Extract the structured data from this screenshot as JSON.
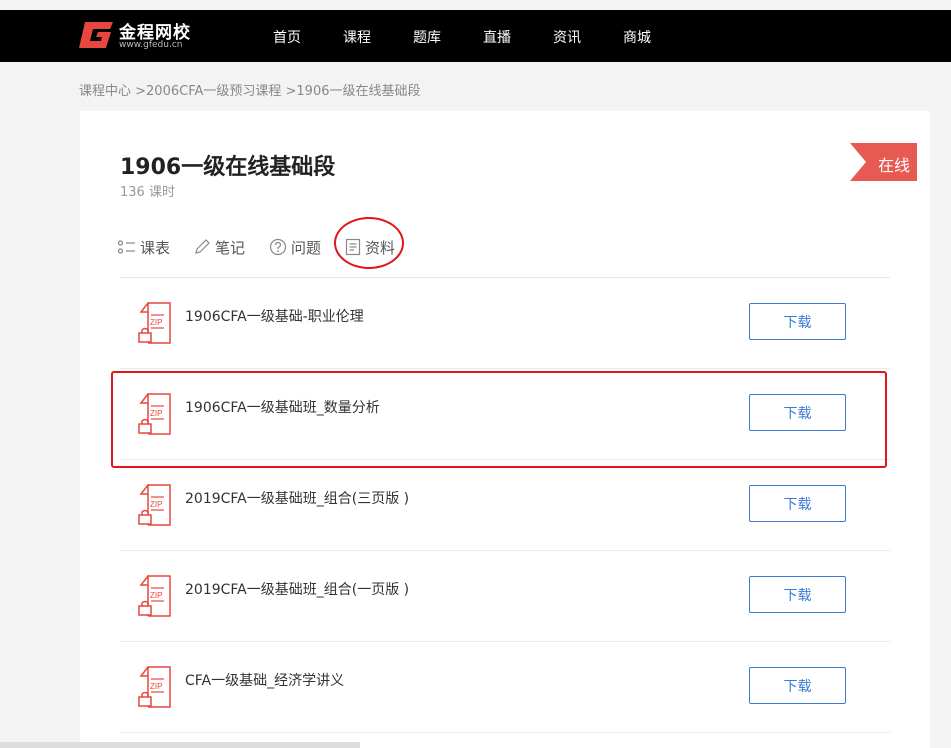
{
  "header": {
    "logo_name": "金程网校",
    "logo_url": "www.gfedu.cn",
    "nav": [
      "首页",
      "课程",
      "题库",
      "直播",
      "资讯",
      "商城"
    ]
  },
  "breadcrumb": [
    "课程中心 >",
    "2006CFA一级预习课程 >",
    "1906一级在线基础段"
  ],
  "course": {
    "title": "1906一级在线基础段",
    "hours": "136 课时",
    "badge": "在线"
  },
  "tabs": [
    {
      "label": "课表",
      "icon": "list-icon"
    },
    {
      "label": "笔记",
      "icon": "pencil-icon"
    },
    {
      "label": "问题",
      "icon": "question-icon"
    },
    {
      "label": "资料",
      "icon": "document-icon"
    }
  ],
  "files": [
    {
      "name": "1906CFA一级基础-职业伦理",
      "icon": "zip-file-icon",
      "action": "下载"
    },
    {
      "name": "1906CFA一级基础班_数量分析",
      "icon": "zip-file-icon",
      "action": "下载"
    },
    {
      "name": "2019CFA一级基础班_组合(三页版 )",
      "icon": "zip-file-icon",
      "action": "下载"
    },
    {
      "name": "2019CFA一级基础班_组合(一页版 )",
      "icon": "zip-file-icon",
      "action": "下载"
    },
    {
      "name": "CFA一级基础_经济学讲义",
      "icon": "zip-file-icon",
      "action": "下载"
    }
  ],
  "colors": {
    "nav_bg": "#000000",
    "accent_red": "#e0161a",
    "badge_red": "#e65a52",
    "button_blue": "#3a7bd5",
    "zip_red": "#e8473f"
  }
}
